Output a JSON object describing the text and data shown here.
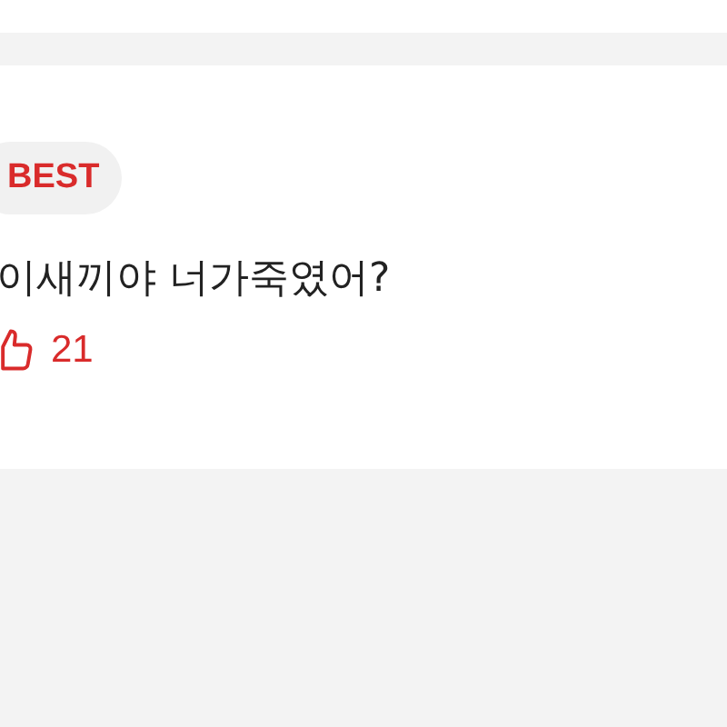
{
  "comment": {
    "badge": "BEST",
    "text": "이새끼야 너가죽였어?",
    "likes": "21",
    "liked": true
  }
}
